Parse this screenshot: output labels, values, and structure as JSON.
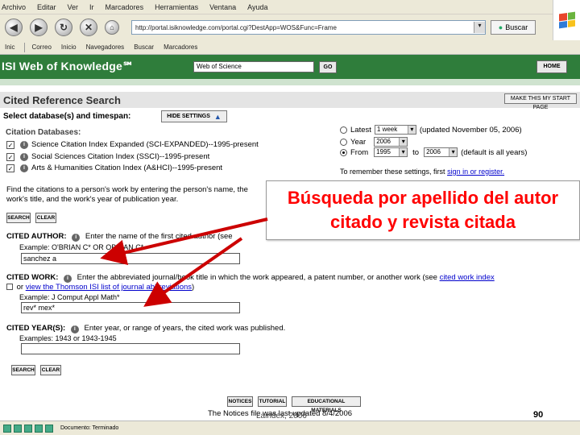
{
  "browser": {
    "menu": [
      "Archivo",
      "Editar",
      "Ver",
      "Ir",
      "Marcadores",
      "Herramientas",
      "Ventana",
      "Ayuda"
    ],
    "address": "http://portal.isiknowledge.com/portal.cgi?DestApp=WOS&Func=Frame",
    "search_button": "Buscar",
    "links": [
      "Inic",
      "Correo",
      "Inicio",
      "Navegadores",
      "Buscar",
      "Marcadores"
    ],
    "status_text": "Documento: Terminado"
  },
  "isi": {
    "title": "ISI Web of Knowledge℠",
    "database_select": "Web of Science",
    "go_label": "GO",
    "home_label": "HOME"
  },
  "page": {
    "title": "Cited Reference Search",
    "make_start_page": "MAKE THIS MY START PAGE",
    "select_heading": "Select database(s) and timespan:",
    "hide_settings": "HIDE SETTINGS",
    "citation_db_heading": "Citation Databases:",
    "databases": [
      {
        "label": "Science Citation Index Expanded (SCI-EXPANDED)--1995-present",
        "checked": true
      },
      {
        "label": "Social Sciences Citation Index (SSCI)--1995-present",
        "checked": true
      },
      {
        "label": "Arts & Humanities Citation Index (A&HCI)--1995-present",
        "checked": true
      }
    ],
    "timespan": {
      "latest_label": "Latest",
      "latest_value": "1 week",
      "latest_note": "(updated November 05, 2006)",
      "year_label": "Year",
      "year_value": "2006",
      "from_label": "From",
      "from_value": "1995",
      "to_label": "to",
      "to_value": "2006",
      "from_note": "(default is all years)"
    },
    "remember_text": "To remember these settings, first ",
    "remember_link": "sign in or register.",
    "find_text": "Find the citations to a person's work by entering the person's name, the work's title, and the work's year of publication year.",
    "search_label": "SEARCH",
    "clear_label": "CLEAR",
    "cited_author": {
      "label": "CITED AUTHOR:",
      "instruction": "Enter the name of the first cited author (see",
      "example": "Example: O'BRIAN C* OR OBRIAN C*",
      "value": "sanchez a"
    },
    "cited_work": {
      "label": "CITED WORK:",
      "instruction": "Enter the abbreviated journal/book title in which the work appeared, a patent number, or another work (see",
      "instruction_link": "cited work index",
      "view_link": "view the Thomson ISI list of journal abbreviations",
      "view_prefix": "or",
      "view_suffix": ")",
      "example": "Example: J Comput Appl Math*",
      "value": "rev* mex*"
    },
    "cited_year": {
      "label": "CITED YEAR(S):",
      "instruction": "Enter year, or range of years, the cited work was published.",
      "example": "Examples: 1943 or 1943-1945",
      "value": ""
    },
    "bottom_buttons": [
      "NOTICES",
      "TUTORIAL",
      "EDUCATIONAL MATERIALS"
    ],
    "notice_text": "The Notices file was last updated 8/4/2006"
  },
  "slide": {
    "callout": "Búsqueda por apellido del autor citado y revista citada",
    "footer": "Laindex, 2006",
    "number": "90"
  },
  "colors": {
    "isi_green": "#2f7d3b",
    "callout_text": "#ff0000",
    "arrow": "#cc0000"
  }
}
